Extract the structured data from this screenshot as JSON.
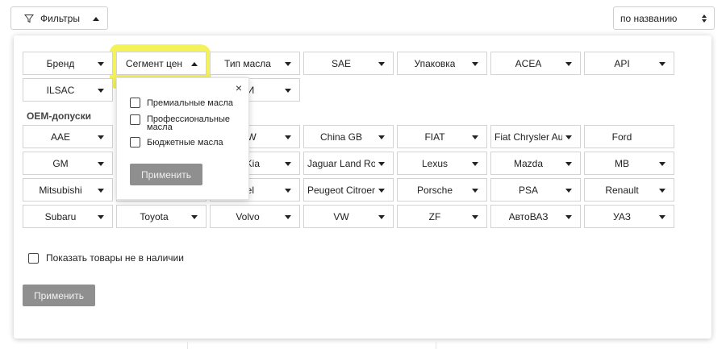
{
  "toolbar": {
    "filters_label": "Фильтры",
    "sort_value": "по названию"
  },
  "filters": {
    "row1": [
      "Бренд",
      "Сегмент цен",
      "Тип масла",
      "SAE",
      "Упаковка",
      "ACEA",
      "API"
    ],
    "row2": [
      "ILSAC",
      "ЛИ"
    ],
    "oem_title": "OEM-допуски",
    "oem_row1": [
      "AAE",
      "",
      "MW",
      "China GB",
      "FIAT",
      "Fiat Chrysler Aut",
      "Ford"
    ],
    "oem_row2": [
      "GM",
      "",
      "ai/Kia",
      "Jaguar Land Rov",
      "Lexus",
      "Mazda",
      "MB"
    ],
    "oem_row3": [
      "Mitsubishi",
      "",
      "pel",
      "Peugeot Citroen",
      "Porsche",
      "PSA",
      "Renault"
    ],
    "oem_row4": [
      "Subaru",
      "Toyota",
      "Volvo",
      "VW",
      "ZF",
      "АвтоВАЗ",
      "УАЗ"
    ]
  },
  "dropdown": {
    "close": "×",
    "options": [
      "Премиальные масла",
      "Профессиональные масла",
      "Бюджетные масла"
    ],
    "apply_label": "Применить"
  },
  "stock_label": "Показать товары не в наличии",
  "apply_label": "Применить",
  "colors": {
    "highlight": "#f3f14b",
    "apply_bg": "#8f8f8f"
  }
}
